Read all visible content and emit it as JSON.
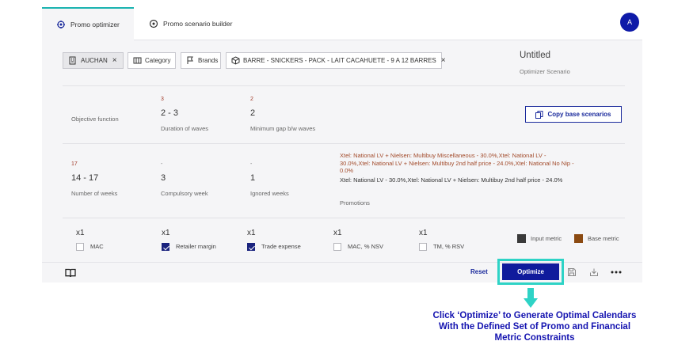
{
  "tabs": [
    {
      "label": "Promo optimizer",
      "active": true,
      "icon": "optimizer-icon"
    },
    {
      "label": "Promo scenario builder",
      "active": false,
      "icon": "scenario-builder-icon"
    }
  ],
  "user": {
    "avatar_initial": "A"
  },
  "filters": [
    {
      "label": "AUCHAN",
      "icon": "store-icon",
      "removable": true
    },
    {
      "label": "Category",
      "icon": "category-icon",
      "removable": false
    },
    {
      "label": "Brands",
      "icon": "flag-icon",
      "removable": false
    },
    {
      "label": "BARRE - SNICKERS - PACK - LAIT CACAHUETE - 9 A 12 BARRES",
      "icon": "box-icon",
      "removable": true
    }
  ],
  "scenario": {
    "title": "Untitled",
    "subtitle": "Optimizer Scenario"
  },
  "constraints_row1": {
    "objective_label": "Objective function",
    "duration": {
      "base": "3",
      "value": "2 - 3",
      "label": "Duration of waves"
    },
    "gap": {
      "base": "2",
      "value": "2",
      "label": "Minimum gap b/w waves"
    },
    "copy_button": "Copy base scenarios"
  },
  "constraints_row2": {
    "weeks": {
      "base": "17",
      "value": "14 - 17",
      "label": "Number of weeks"
    },
    "compulsory": {
      "base": "-",
      "value": "3",
      "label": "Compulsory week"
    },
    "ignored": {
      "base": "-",
      "value": "1",
      "label": "Ignored weeks"
    },
    "promotions": {
      "base": "Xtel: National LV + Nielsen: Multibuy Miscellaneous - 30.0%,Xtel: National LV - 30.0%,Xtel: National LV + Nielsen: Multibuy 2nd half price - 24.0%,Xtel: National No Nip - 0.0%",
      "value": "Xtel: National LV - 30.0%,Xtel: National LV + Nielsen: Multibuy 2nd half price - 24.0%",
      "label": "Promotions"
    }
  },
  "metrics": [
    {
      "multiplier": "x1",
      "label": "MAC",
      "checked": false
    },
    {
      "multiplier": "x1",
      "label": "Retailer margin",
      "checked": true
    },
    {
      "multiplier": "x1",
      "label": "Trade expense",
      "checked": true
    },
    {
      "multiplier": "x1",
      "label": "MAC, % NSV",
      "checked": false
    },
    {
      "multiplier": "x1",
      "label": "TM, % RSV",
      "checked": false
    }
  ],
  "legend": [
    {
      "label": "Input metric",
      "color": "#3a3a3a"
    },
    {
      "label": "Base metric",
      "color": "#8b4a12"
    }
  ],
  "actions": {
    "reset": "Reset",
    "optimize": "Optimize"
  },
  "callout": {
    "text": "Click ‘Optimize’ to Generate Optimal Calendars With the Defined Set of Promo and Financial Metric Constraints"
  },
  "colors": {
    "accent": "#1ab3b0",
    "primary": "#101b9c",
    "callout": "#1413b0",
    "highlight": "#2ed3c6"
  }
}
